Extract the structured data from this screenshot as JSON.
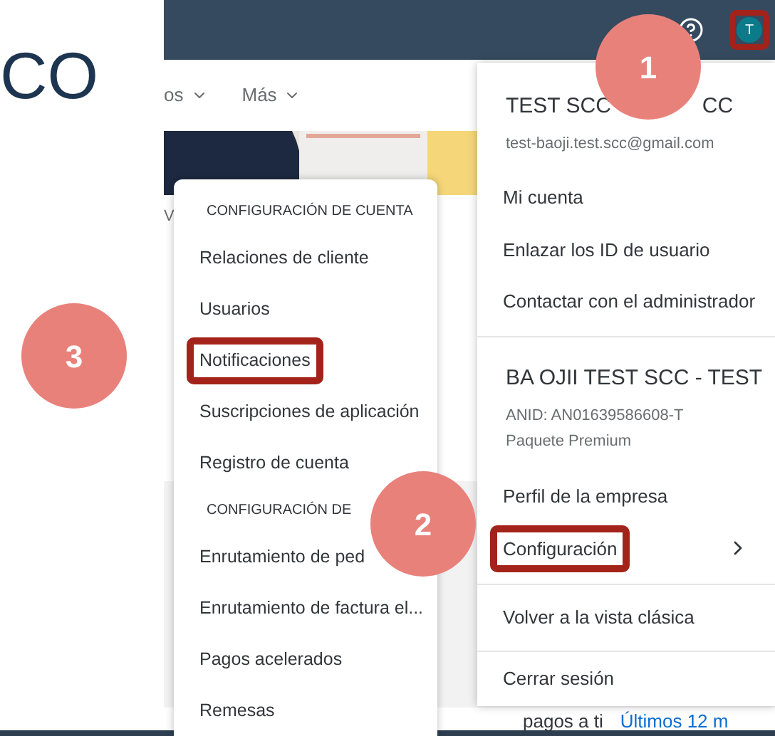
{
  "page_title_fragment": "CO",
  "nav": [
    {
      "label": "os"
    },
    {
      "label": "Más"
    }
  ],
  "hero_fragment": "V",
  "bottom_row": {
    "label": "pagos a ti",
    "period": "Últimos 12 m"
  },
  "user_avatar": {
    "initial": "T",
    "highlighted": true
  },
  "user_menu": {
    "name_start": "TEST SCC",
    "name_end": "CC",
    "email": "test-baoji.test.scc@gmail.com",
    "account_items": [
      {
        "label": "Mi cuenta",
        "highlighted": false
      },
      {
        "label": "Enlazar los ID de usuario",
        "highlighted": false
      },
      {
        "label": "Contactar con el administrador",
        "highlighted": false
      }
    ],
    "company": "BA OJII TEST SCC - TEST",
    "anid": "ANID: AN01639586608-T",
    "package": "Paquete Premium",
    "company_items": [
      {
        "label": "Perfil de la empresa",
        "highlighted": false,
        "submenu": false
      },
      {
        "label": "Configuración",
        "highlighted": true,
        "submenu": true
      }
    ],
    "classic": "Volver a la vista clásica",
    "logout": "Cerrar sesión"
  },
  "settings_menu": [
    {
      "kind": "header",
      "label": "CONFIGURACIÓN DE CUENTA"
    },
    {
      "kind": "item",
      "label": "Relaciones de cliente",
      "highlighted": false
    },
    {
      "kind": "item",
      "label": "Usuarios",
      "highlighted": false
    },
    {
      "kind": "item",
      "label": "Notificaciones",
      "highlighted": true
    },
    {
      "kind": "item",
      "label": "Suscripciones de aplicación",
      "highlighted": false
    },
    {
      "kind": "item",
      "label": "Registro de cuenta",
      "highlighted": false
    },
    {
      "kind": "header",
      "label": "CONFIGURACIÓN DE"
    },
    {
      "kind": "item",
      "label": "Enrutamiento de ped",
      "highlighted": false
    },
    {
      "kind": "item",
      "label": "Enrutamiento de factura el...",
      "highlighted": false
    },
    {
      "kind": "item",
      "label": "Pagos acelerados",
      "highlighted": false
    },
    {
      "kind": "item",
      "label": "Remesas",
      "highlighted": false
    }
  ],
  "step_markers": [
    "1",
    "2",
    "3"
  ]
}
